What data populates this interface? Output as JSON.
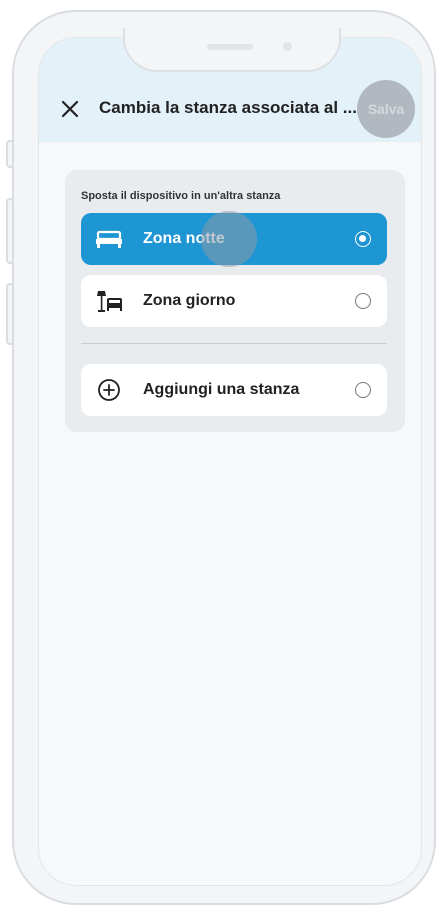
{
  "header": {
    "title": "Cambia la stanza associata al ...",
    "save_label": "Salva",
    "close_icon": "close-icon"
  },
  "panel": {
    "label": "Sposta il dispositivo in un'altra stanza",
    "rooms": [
      {
        "label": "Zona notte",
        "icon": "bed-icon",
        "selected": true
      },
      {
        "label": "Zona giorno",
        "icon": "living-room-icon",
        "selected": false
      }
    ],
    "add_room": {
      "label": "Aggiungi una stanza",
      "icon": "add-circle-icon",
      "selected": false
    }
  },
  "colors": {
    "header_bg": "#e3f1f8",
    "accent": "#1e96d3",
    "panel_bg": "#e9ecef",
    "save_disabled": "#b1b8bf"
  }
}
